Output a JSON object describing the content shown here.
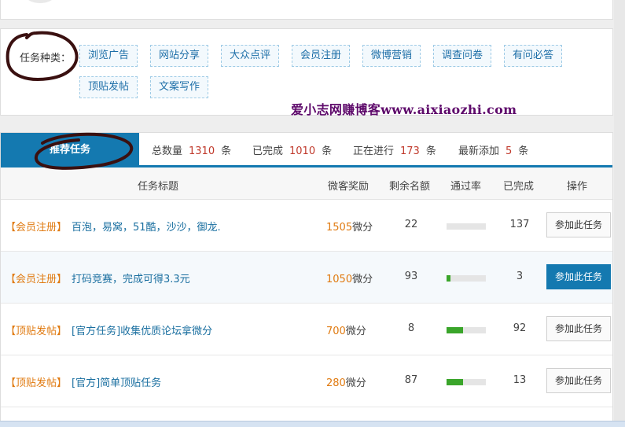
{
  "categories": {
    "label": "任务种类：",
    "items": [
      "浏览广告",
      "网站分享",
      "大众点评",
      "会员注册",
      "微博营销",
      "调查问卷",
      "有问必答",
      "顶贴发帖",
      "文案写作"
    ]
  },
  "watermark": "爱小志网赚博客www.aixiaozhi.com",
  "stats": {
    "tab_label": "推荐任务",
    "total_label": "总数量",
    "total_value": "1310",
    "total_unit": "条",
    "done_label": "已完成",
    "done_value": "1010",
    "done_unit": "条",
    "ongoing_label": "正在进行",
    "ongoing_value": "173",
    "ongoing_unit": "条",
    "new_label": "最新添加",
    "new_value": "5",
    "new_unit": "条"
  },
  "table": {
    "headers": {
      "title": "任务标题",
      "reward": "微客奖励",
      "remain": "剩余名额",
      "pass_rate": "通过率",
      "done": "已完成",
      "action": "操作"
    },
    "rows": [
      {
        "category": "【会员注册】",
        "title": "百泡，易窝，51酷，沙沙，御龙.",
        "reward": "1505",
        "reward_unit": "微分",
        "remain": "22",
        "pass_rate": 0.0,
        "done": "137",
        "action": "参加此任务",
        "primary": false
      },
      {
        "category": "【会员注册】",
        "title": "打码竞赛，完成可得3.3元",
        "reward": "1050",
        "reward_unit": "微分",
        "remain": "93",
        "pass_rate": 0.1,
        "done": "3",
        "action": "参加此任务",
        "primary": true
      },
      {
        "category": "【顶贴发帖】",
        "title": "[官方任务]收集优质论坛拿微分",
        "reward": "700",
        "reward_unit": "微分",
        "remain": "8",
        "pass_rate": 0.42,
        "done": "92",
        "action": "参加此任务",
        "primary": false
      },
      {
        "category": "【顶贴发帖】",
        "title": "[官方]简单顶贴任务",
        "reward": "280",
        "reward_unit": "微分",
        "remain": "87",
        "pass_rate": 0.42,
        "done": "13",
        "action": "参加此任务",
        "primary": false
      }
    ]
  },
  "colors": {
    "accent": "#1479b0",
    "category_orange": "#e07a10",
    "number_red": "#c0392b",
    "progress_green": "#3aa52a",
    "annotation": "#3a1010"
  }
}
